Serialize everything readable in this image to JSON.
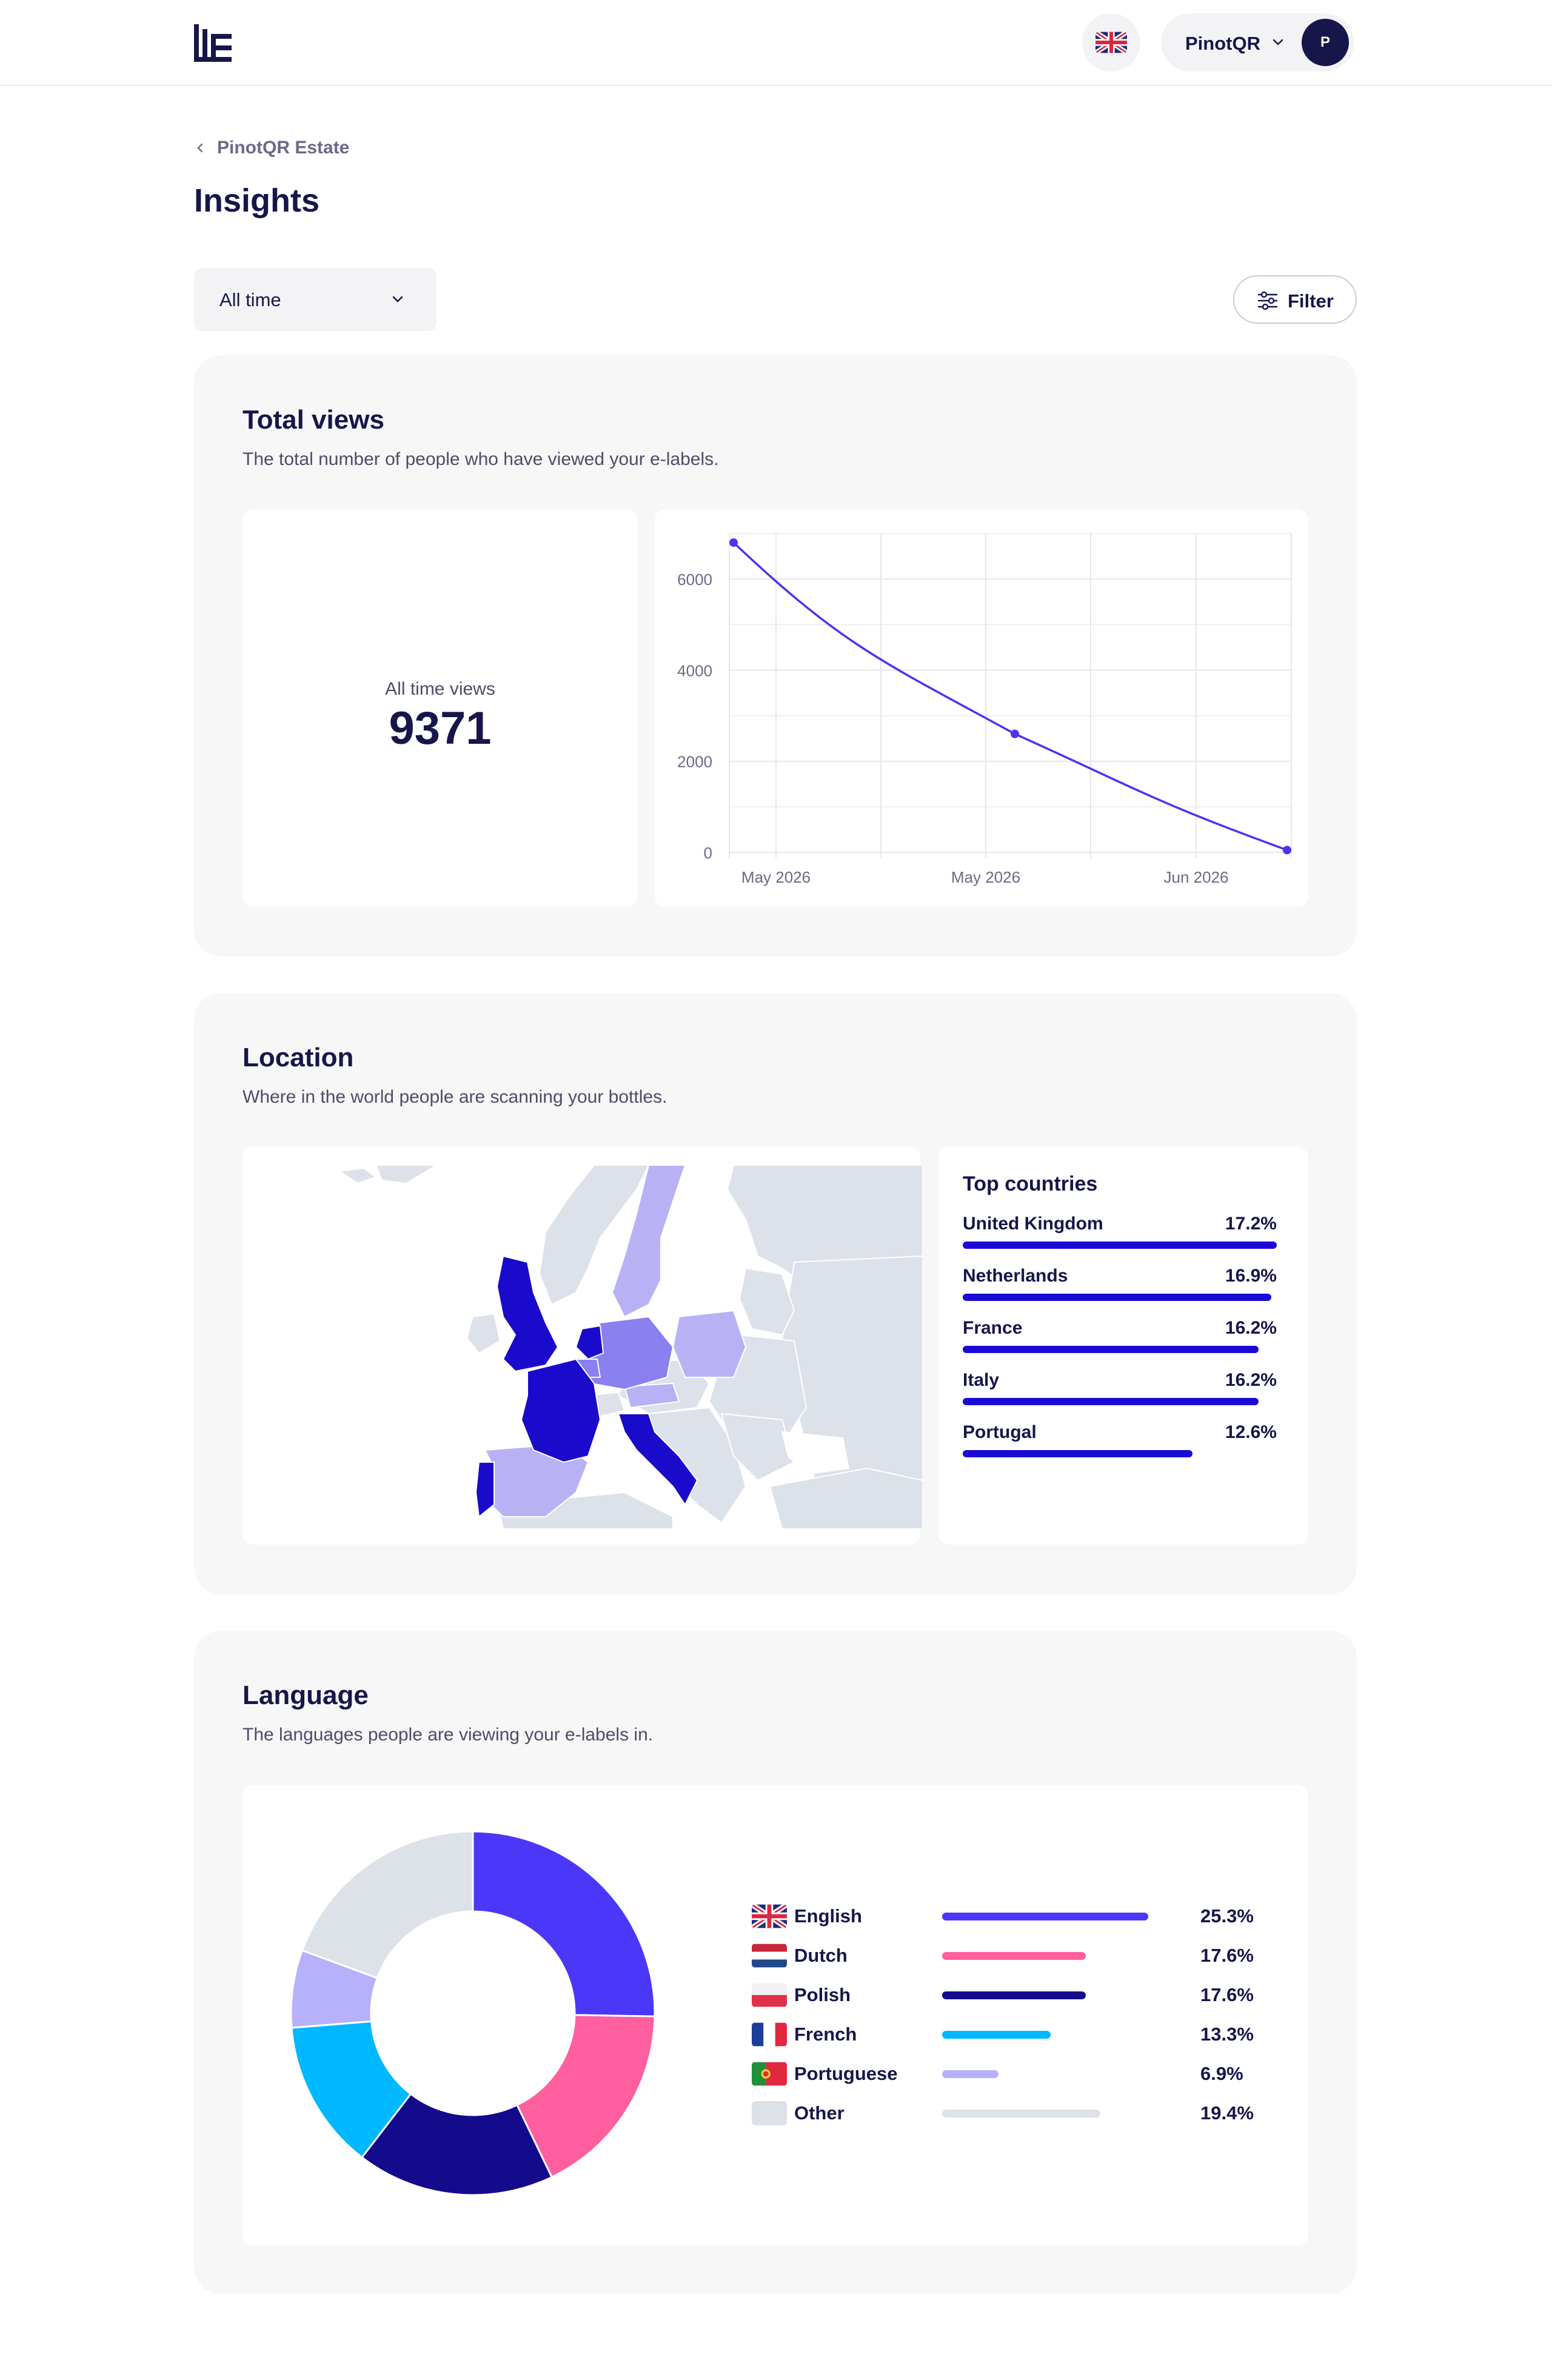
{
  "header": {
    "account_name": "PinotQR",
    "avatar_initial": "P",
    "language_flag": "united-kingdom-flag-icon"
  },
  "breadcrumb": {
    "label": "PinotQR Estate"
  },
  "page": {
    "title": "Insights"
  },
  "controls": {
    "time_range": "All time",
    "filter_label": "Filter"
  },
  "total_views": {
    "title": "Total views",
    "subtitle": "The total number of people who have viewed your e-labels.",
    "all_time_label": "All time views",
    "all_time_value": "9371"
  },
  "location": {
    "title": "Location",
    "subtitle": "Where in the world people are scanning your bottles.",
    "top_countries_title": "Top countries",
    "countries": [
      {
        "name": "United Kingdom",
        "percent": "17.2%",
        "share": 17.2
      },
      {
        "name": "Netherlands",
        "percent": "16.9%",
        "share": 16.9
      },
      {
        "name": "France",
        "percent": "16.2%",
        "share": 16.2
      },
      {
        "name": "Italy",
        "percent": "16.2%",
        "share": 16.2
      },
      {
        "name": "Portugal",
        "percent": "12.6%",
        "share": 12.6
      }
    ]
  },
  "language": {
    "title": "Language",
    "subtitle": "The languages people are viewing your e-labels in."
  },
  "colors": {
    "navy": "#16164a",
    "line": "#4a34f0",
    "map_dark": "#1a0acb",
    "map_mid": "#8a80f0",
    "map_light": "#b8b2f5",
    "map_base": "#dde2ea"
  },
  "chart_data": [
    {
      "type": "line",
      "title": "",
      "xlabel": "",
      "ylabel": "",
      "x": [
        "2026-05-01",
        "2026-05-31",
        "2026-06-30"
      ],
      "x_tick_labels": [
        "May 2026",
        "May 2026",
        "Jun 2026"
      ],
      "y_ticks": [
        0,
        2000,
        4000,
        6000
      ],
      "ylim": [
        0,
        7000
      ],
      "grid": true,
      "series": [
        {
          "values": [
            6800,
            2600,
            50
          ]
        }
      ]
    },
    {
      "type": "pie",
      "title": "",
      "categories": [
        "English",
        "Dutch",
        "Polish",
        "French",
        "Portuguese",
        "Other"
      ],
      "values": [
        25.3,
        17.6,
        17.6,
        13.3,
        6.9,
        19.4
      ],
      "labels": [
        "25.3%",
        "17.6%",
        "17.6%",
        "13.3%",
        "6.9%",
        "19.4%"
      ],
      "colors": [
        "#4b37f7",
        "#ff5f9e",
        "#140a8c",
        "#00b8ff",
        "#b7b1fb",
        "#dde1e8"
      ],
      "flags": [
        "united-kingdom-flag-icon",
        "netherlands-flag-icon",
        "poland-flag-icon",
        "france-flag-icon",
        "portugal-flag-icon",
        "other-placeholder-icon"
      ],
      "legend": "right"
    }
  ]
}
